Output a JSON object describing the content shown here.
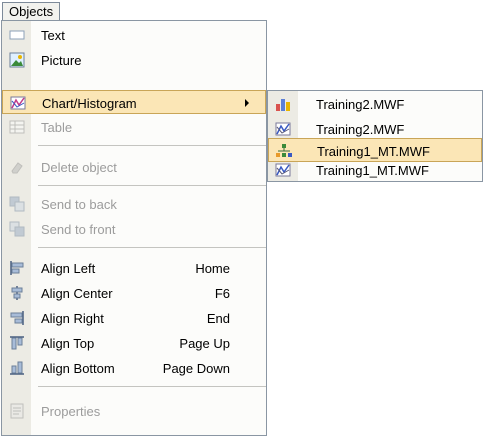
{
  "menubar": {
    "objects_label": "Objects"
  },
  "menu": {
    "items": [
      {
        "label": "Text",
        "shortcut": ""
      },
      {
        "label": "Picture",
        "shortcut": ""
      },
      {
        "label": "Chart/Histogram",
        "shortcut": ""
      },
      {
        "label": "Table",
        "shortcut": ""
      },
      {
        "label": "Delete object",
        "shortcut": ""
      },
      {
        "label": "Send to back",
        "shortcut": ""
      },
      {
        "label": "Send to front",
        "shortcut": ""
      },
      {
        "label": "Align Left",
        "shortcut": "Home"
      },
      {
        "label": "Align Center",
        "shortcut": "F6"
      },
      {
        "label": "Align Right",
        "shortcut": "End"
      },
      {
        "label": "Align Top",
        "shortcut": "Page Up"
      },
      {
        "label": "Align Bottom",
        "shortcut": "Page Down"
      },
      {
        "label": "Properties",
        "shortcut": ""
      }
    ]
  },
  "submenu": {
    "items": [
      {
        "label": "Training2.MWF",
        "icon": "bar-chart-icon"
      },
      {
        "label": "Training2.MWF",
        "icon": "histogram-icon"
      },
      {
        "label": "Training1_MT.MWF",
        "icon": "tree-diagram-icon"
      },
      {
        "label": "Training1_MT.MWF",
        "icon": "histogram-icon"
      }
    ]
  },
  "colors": {
    "highlight_bg": "#fbe6b6",
    "highlight_border": "#c9a557",
    "icon_strip": "#ecebe4",
    "disabled_text": "#9c9c9c"
  }
}
